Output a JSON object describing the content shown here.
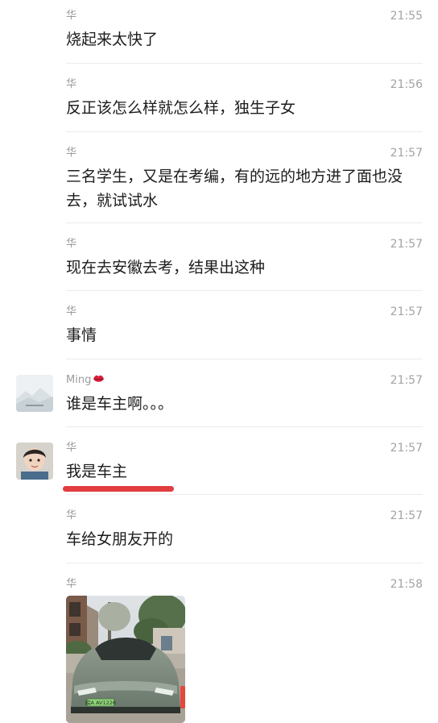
{
  "messages": [
    {
      "sender": "华",
      "time": "21:55",
      "text": "烧起来太快了"
    },
    {
      "sender": "华",
      "time": "21:56",
      "text": "反正该怎么样就怎么样，独生子女"
    },
    {
      "sender": "华",
      "time": "21:57",
      "text": "三名学生，又是在考编，有的远的地方进了面也没去，就试试水"
    },
    {
      "sender": "华",
      "time": "21:57",
      "text": "现在去安徽去考，结果出这种"
    },
    {
      "sender": "华",
      "time": "21:57",
      "text": "事情"
    },
    {
      "sender": "Ming",
      "time": "21:57",
      "text": "谁是车主啊。。。",
      "name_icon": "lips-icon"
    },
    {
      "sender": "华",
      "time": "21:57",
      "text": "我是车主"
    },
    {
      "sender": "华",
      "time": "21:57",
      "text": "车给女朋友开的"
    },
    {
      "sender": "华",
      "time": "21:58",
      "image": "car-photo"
    }
  ],
  "car_photo": {
    "plate": "皖A AV1226"
  },
  "colors": {
    "annotation_underline": "#e23d3f",
    "time": "#a3a3a3",
    "name": "#9b9b9b",
    "divider": "#ececec"
  }
}
